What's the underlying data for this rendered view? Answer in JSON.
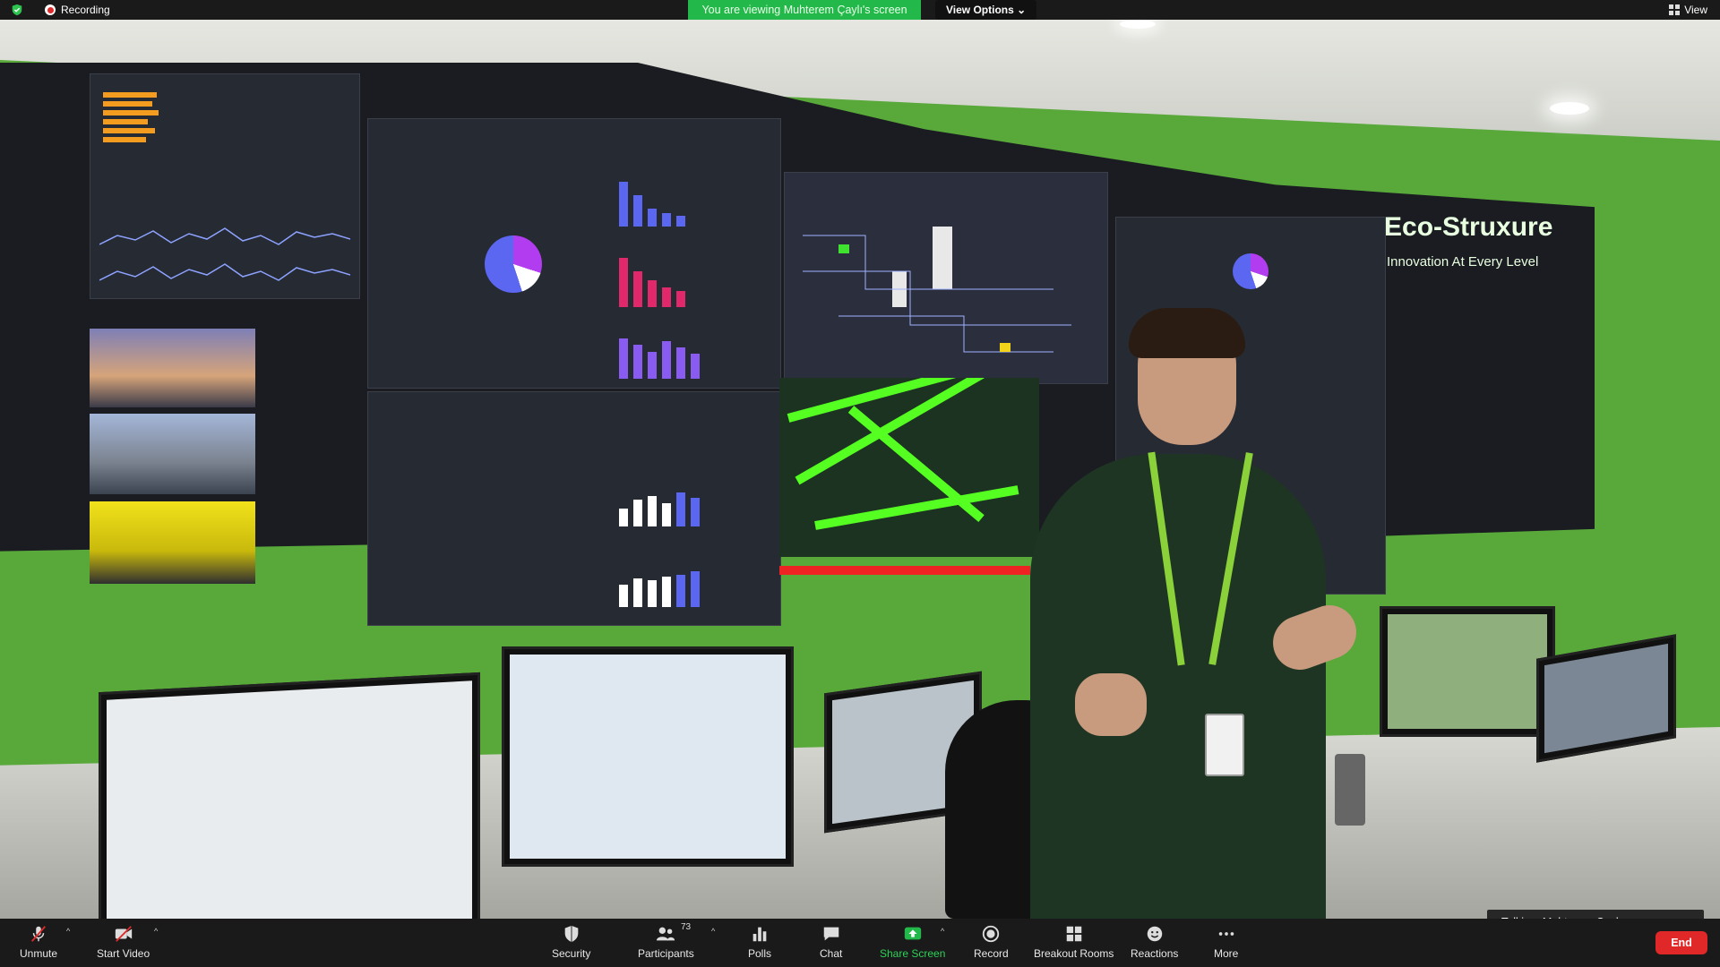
{
  "topbar": {
    "recording_label": "Recording",
    "banner": "You are viewing Muhterem Çaylı's screen",
    "view_options": "View Options",
    "view": "View"
  },
  "video": {
    "logo": "Eco‑Struxure",
    "tagline": "Innovation At Every Level",
    "talking": "Talking: Muhterem Çaylı"
  },
  "toolbar": {
    "unmute": "Unmute",
    "start_video": "Start Video",
    "security": "Security",
    "participants": "Participants",
    "participants_count": "73",
    "polls": "Polls",
    "chat": "Chat",
    "share_screen": "Share Screen",
    "record": "Record",
    "breakout_rooms": "Breakout Rooms",
    "reactions": "Reactions",
    "more": "More",
    "end": "End"
  },
  "colors": {
    "banner_green": "#23b84a",
    "share_green": "#23b84a",
    "end_red": "#e02828",
    "wall_green": "#58a83a"
  }
}
